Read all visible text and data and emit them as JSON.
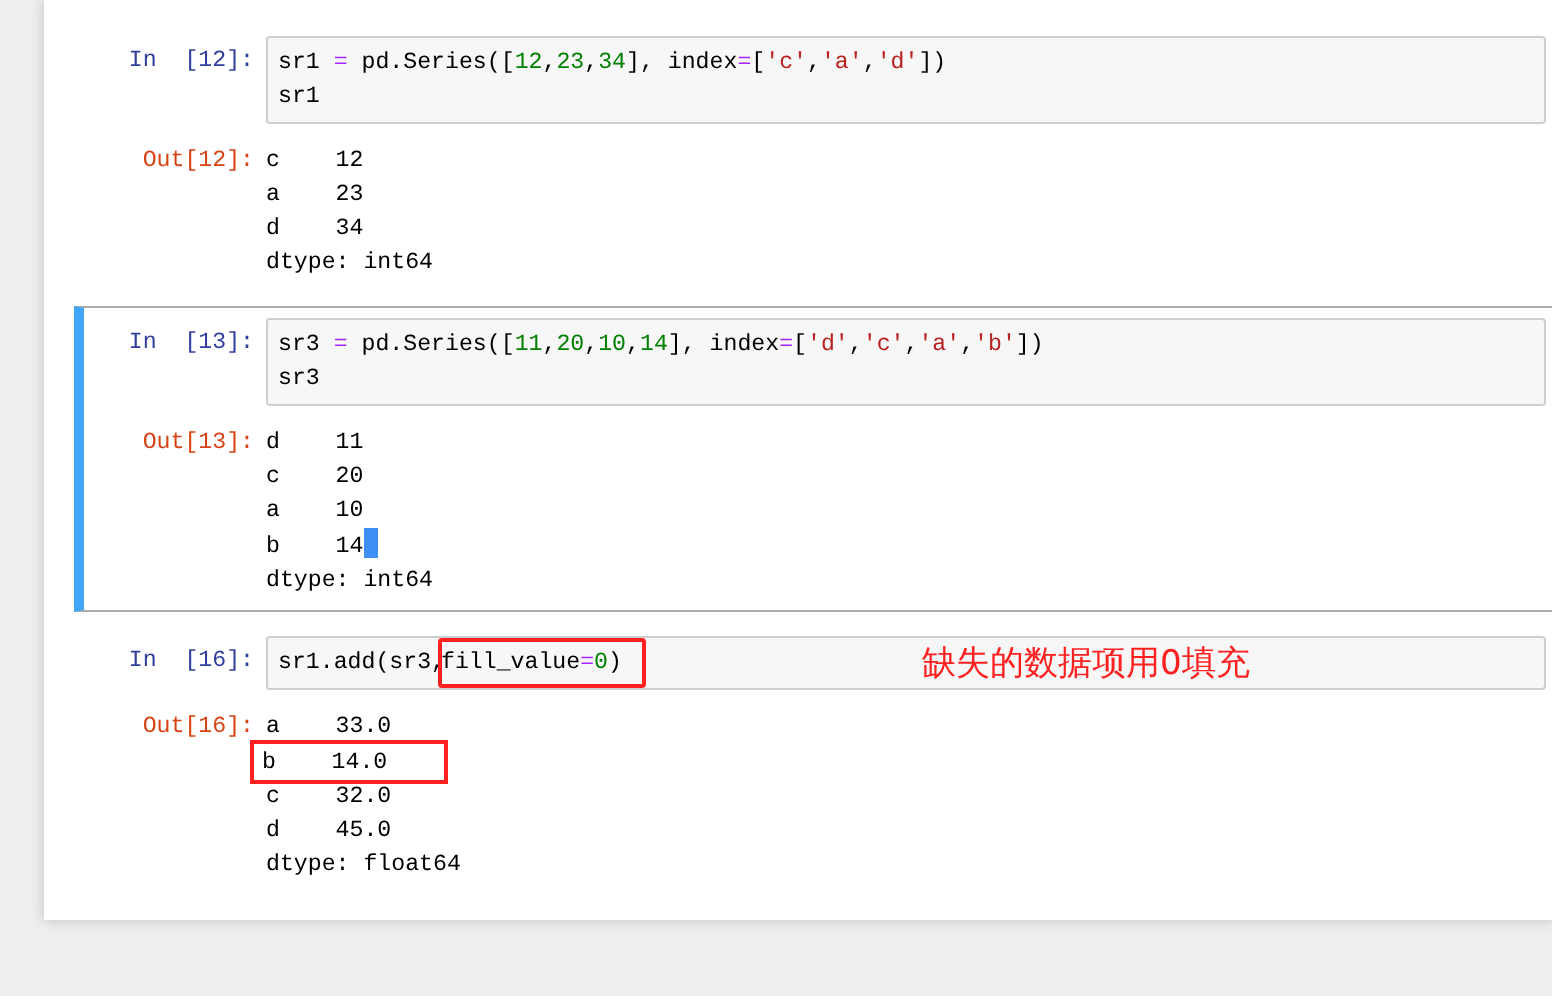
{
  "cells": [
    {
      "prompt_in": "In  [12]:",
      "selected": false,
      "code": [
        [
          {
            "boxed": false,
            "tokens": [
              {
                "t": "sr1 ",
                "kind": "plain"
              },
              {
                "t": "=",
                "kind": "op"
              },
              {
                "t": " pd.Series([",
                "kind": "plain"
              },
              {
                "t": "12",
                "kind": "num"
              },
              {
                "t": ",",
                "kind": "plain"
              },
              {
                "t": "23",
                "kind": "num"
              },
              {
                "t": ",",
                "kind": "plain"
              },
              {
                "t": "34",
                "kind": "num"
              },
              {
                "t": "], index",
                "kind": "plain"
              },
              {
                "t": "=",
                "kind": "op"
              },
              {
                "t": "[",
                "kind": "plain"
              },
              {
                "t": "'c'",
                "kind": "str"
              },
              {
                "t": ",",
                "kind": "plain"
              },
              {
                "t": "'a'",
                "kind": "str"
              },
              {
                "t": ",",
                "kind": "plain"
              },
              {
                "t": "'d'",
                "kind": "str"
              },
              {
                "t": "])",
                "kind": "plain"
              }
            ]
          }
        ],
        [
          {
            "boxed": false,
            "tokens": [
              {
                "t": "sr1",
                "kind": "plain"
              }
            ]
          }
        ]
      ],
      "prompt_out": "Out[12]:",
      "output": [
        {
          "text": "c    12",
          "boxed": false,
          "cursor": false
        },
        {
          "text": "a    23",
          "boxed": false,
          "cursor": false
        },
        {
          "text": "d    34",
          "boxed": false,
          "cursor": false
        },
        {
          "text": "dtype: int64",
          "boxed": false,
          "cursor": false
        }
      ]
    },
    {
      "prompt_in": "In  [13]:",
      "selected": true,
      "code": [
        [
          {
            "boxed": false,
            "tokens": [
              {
                "t": "sr3 ",
                "kind": "plain"
              },
              {
                "t": "=",
                "kind": "op"
              },
              {
                "t": " pd.Series([",
                "kind": "plain"
              },
              {
                "t": "11",
                "kind": "num"
              },
              {
                "t": ",",
                "kind": "plain"
              },
              {
                "t": "20",
                "kind": "num"
              },
              {
                "t": ",",
                "kind": "plain"
              },
              {
                "t": "10",
                "kind": "num"
              },
              {
                "t": ",",
                "kind": "plain"
              },
              {
                "t": "14",
                "kind": "num"
              },
              {
                "t": "], index",
                "kind": "plain"
              },
              {
                "t": "=",
                "kind": "op"
              },
              {
                "t": "[",
                "kind": "plain"
              },
              {
                "t": "'d'",
                "kind": "str"
              },
              {
                "t": ",",
                "kind": "plain"
              },
              {
                "t": "'c'",
                "kind": "str"
              },
              {
                "t": ",",
                "kind": "plain"
              },
              {
                "t": "'a'",
                "kind": "str"
              },
              {
                "t": ",",
                "kind": "plain"
              },
              {
                "t": "'b'",
                "kind": "str"
              },
              {
                "t": "])",
                "kind": "plain"
              }
            ]
          }
        ],
        [
          {
            "boxed": false,
            "tokens": [
              {
                "t": "sr3",
                "kind": "plain"
              }
            ]
          }
        ]
      ],
      "prompt_out": "Out[13]:",
      "output": [
        {
          "text": "d    11",
          "boxed": false,
          "cursor": false
        },
        {
          "text": "c    20",
          "boxed": false,
          "cursor": false
        },
        {
          "text": "a    10",
          "boxed": false,
          "cursor": false
        },
        {
          "text": "b    14",
          "boxed": false,
          "cursor": true
        },
        {
          "text": "dtype: int64",
          "boxed": false,
          "cursor": false
        }
      ]
    },
    {
      "prompt_in": "In  [16]:",
      "selected": false,
      "code": [
        [
          {
            "boxed": false,
            "tokens": [
              {
                "t": "sr1.add(sr3,",
                "kind": "plain"
              }
            ]
          },
          {
            "boxed": true,
            "tokens": [
              {
                "t": "fill_value",
                "kind": "plain"
              },
              {
                "t": "=",
                "kind": "op"
              },
              {
                "t": "0",
                "kind": "num"
              },
              {
                "t": ")",
                "kind": "plain"
              }
            ]
          }
        ]
      ],
      "annotation": "缺失的数据项用0填充",
      "prompt_out": "Out[16]:",
      "output": [
        {
          "text": "a    33.0",
          "boxed": false,
          "cursor": false
        },
        {
          "text": "b    14.0",
          "boxed": true,
          "cursor": false
        },
        {
          "text": "c    32.0",
          "boxed": false,
          "cursor": false
        },
        {
          "text": "d    45.0",
          "boxed": false,
          "cursor": false
        },
        {
          "text": "dtype: float64",
          "boxed": false,
          "cursor": false
        }
      ]
    }
  ]
}
